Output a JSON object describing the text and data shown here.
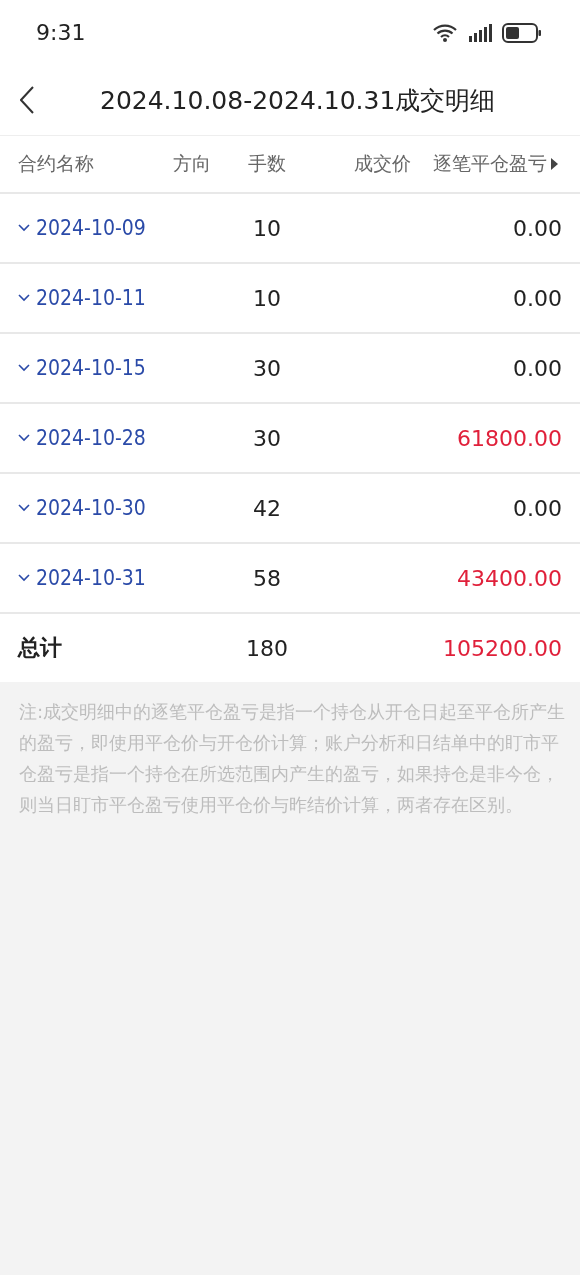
{
  "status_bar": {
    "time": "9:31"
  },
  "header": {
    "title": "2024.10.08-2024.10.31成交明细"
  },
  "table": {
    "columns": [
      {
        "label": "合约名称"
      },
      {
        "label": "方向"
      },
      {
        "label": "手数"
      },
      {
        "label": "成交价"
      },
      {
        "label": "逐笔平仓盈亏",
        "more": true
      }
    ],
    "rows": [
      {
        "date": "2024-10-09",
        "lots": "10",
        "pnl": "0.00",
        "color": "#222222",
        "expanded": false
      },
      {
        "date": "2024-10-11",
        "lots": "10",
        "pnl": "0.00",
        "color": "#222222",
        "expanded": false
      },
      {
        "date": "2024-10-15",
        "lots": "30",
        "pnl": "0.00",
        "color": "#222222",
        "expanded": false
      },
      {
        "date": "2024-10-28",
        "lots": "30",
        "pnl": "61800.00",
        "color": "#e0203a",
        "expanded": false
      },
      {
        "date": "2024-10-30",
        "lots": "42",
        "pnl": "0.00",
        "color": "#222222",
        "expanded": false
      },
      {
        "date": "2024-10-31",
        "lots": "58",
        "pnl": "43400.00",
        "color": "#e0203a",
        "expanded": false
      }
    ],
    "total": {
      "label": "总计",
      "lots": "180",
      "pnl": "105200.00",
      "color": "#e0203a"
    }
  },
  "note": "注:成交明细中的逐笔平仓盈亏是指一个持仓从开仓日起至平仓所产生的盈亏，即使用平仓价与开仓价计算；账户分析和日结单中的盯市平仓盈亏是指一个持仓在所选范围内产生的盈亏，如果持仓是非今仓，则当日盯市平仓盈亏使用平仓价与昨结价计算，两者存在区别。"
}
